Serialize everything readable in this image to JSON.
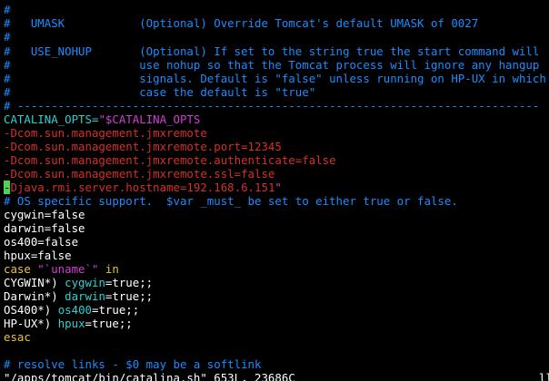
{
  "editor": {
    "comment_block": {
      "line_hash": "#",
      "umask_line": "#   UMASK           (Optional) Override Tomcat's default UMASK of 0027",
      "blank_hash": "#",
      "nohup_line1": "#   USE_NOHUP       (Optional) If set to the string true the start command will",
      "nohup_line2": "#                   use nohup so that the Tomcat process will ignore any hangup",
      "nohup_line3": "#                   signals. Default is \"false\" unless running on HP-UX in which",
      "nohup_line4": "#                   case the default is \"true\"",
      "separator": "# -----------------------------------------------------------------------------"
    },
    "catalina_opts": {
      "var_name": "CATALINA_OPTS=",
      "value_start": "\"$CATALINA_OPTS",
      "opt1": "-Dcom.sun.management.jmxremote",
      "opt2": "-Dcom.sun.management.jmxremote.port=12345",
      "opt3": "-Dcom.sun.management.jmxremote.authenticate=false",
      "opt4": "-Dcom.sun.management.jmxremote.ssl=false",
      "cursor_char": "-",
      "opt5_rest": "Djava.rmi.server.hostname=192.168.6.151",
      "opt5_close": "\""
    },
    "os_comment": "# OS specific support.  $var _must_ be set to either true or false.",
    "os_vars": [
      "cygwin=false",
      "darwin=false",
      "os400=false",
      "hpux=false"
    ],
    "case_stmt": {
      "keyword": "case",
      "arg": " \"`uname`\" ",
      "in_kw": "in"
    },
    "case_branches": [
      {
        "pattern": "CYGWIN*) ",
        "var": "cygwin",
        "rest": "=true;;"
      },
      {
        "pattern": "Darwin*) ",
        "var": "darwin",
        "rest": "=true;;"
      },
      {
        "pattern": "OS400*) ",
        "var": "os400",
        "rest": "=true;;"
      },
      {
        "pattern": "HP-UX*) ",
        "var": "hpux",
        "rest": "=true;;"
      }
    ],
    "esac": "esac",
    "resolve_comment": "# resolve links - $0 may be a softlink"
  },
  "status_bar": {
    "file_info": "\"/apps/tomcat/bin/catalina.sh\" 653L, 23686C",
    "right_text": "ll"
  },
  "colors": {
    "background": "#000000",
    "comment": "#1c8cff",
    "string_red": "#d4302a",
    "keyword_magenta": "#d13fd1",
    "variable_cyan": "#2fd0d0",
    "keyword_yellow": "#e8c23a",
    "cursor": "#4fd44f"
  }
}
